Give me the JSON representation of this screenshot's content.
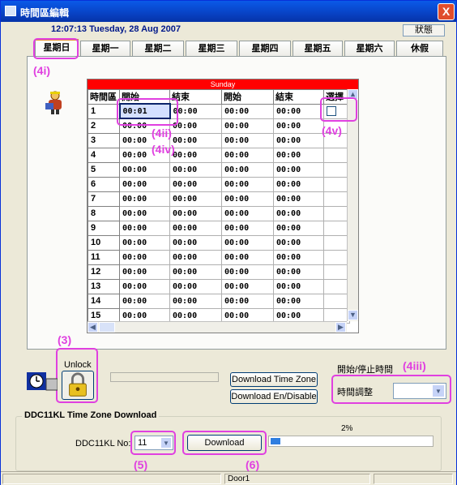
{
  "window": {
    "title": "時間區編輯",
    "close_glyph": "X",
    "clock_text": "12:07:13 Tuesday, 28 Aug 2007",
    "status_button": "狀態"
  },
  "tabs": [
    {
      "label": "星期日",
      "active": true
    },
    {
      "label": "星期一",
      "active": false
    },
    {
      "label": "星期二",
      "active": false
    },
    {
      "label": "星期三",
      "active": false
    },
    {
      "label": "星期四",
      "active": false
    },
    {
      "label": "星期五",
      "active": false
    },
    {
      "label": "星期六",
      "active": false
    },
    {
      "label": "休假",
      "active": false
    }
  ],
  "grid": {
    "day_banner": "Sunday",
    "headers": [
      "時間區",
      "開始",
      "結束",
      "開始",
      "結束",
      "選擇"
    ],
    "rows": [
      {
        "num": "1",
        "s1": "00:01",
        "e1": "00:00",
        "s2": "00:00",
        "e2": "00:00"
      },
      {
        "num": "2",
        "s1": "00:00",
        "e1": "00:00",
        "s2": "00:00",
        "e2": "00:00"
      },
      {
        "num": "3",
        "s1": "00:00",
        "e1": "00:00",
        "s2": "00:00",
        "e2": "00:00"
      },
      {
        "num": "4",
        "s1": "00:00",
        "e1": "00:00",
        "s2": "00:00",
        "e2": "00:00"
      },
      {
        "num": "5",
        "s1": "00:00",
        "e1": "00:00",
        "s2": "00:00",
        "e2": "00:00"
      },
      {
        "num": "6",
        "s1": "00:00",
        "e1": "00:00",
        "s2": "00:00",
        "e2": "00:00"
      },
      {
        "num": "7",
        "s1": "00:00",
        "e1": "00:00",
        "s2": "00:00",
        "e2": "00:00"
      },
      {
        "num": "8",
        "s1": "00:00",
        "e1": "00:00",
        "s2": "00:00",
        "e2": "00:00"
      },
      {
        "num": "9",
        "s1": "00:00",
        "e1": "00:00",
        "s2": "00:00",
        "e2": "00:00"
      },
      {
        "num": "10",
        "s1": "00:00",
        "e1": "00:00",
        "s2": "00:00",
        "e2": "00:00"
      },
      {
        "num": "11",
        "s1": "00:00",
        "e1": "00:00",
        "s2": "00:00",
        "e2": "00:00"
      },
      {
        "num": "12",
        "s1": "00:00",
        "e1": "00:00",
        "s2": "00:00",
        "e2": "00:00"
      },
      {
        "num": "13",
        "s1": "00:00",
        "e1": "00:00",
        "s2": "00:00",
        "e2": "00:00"
      },
      {
        "num": "14",
        "s1": "00:00",
        "e1": "00:00",
        "s2": "00:00",
        "e2": "00:00"
      },
      {
        "num": "15",
        "s1": "00:00",
        "e1": "00:00",
        "s2": "00:00",
        "e2": "00:00"
      }
    ]
  },
  "annotations": {
    "a3": "(3)",
    "a4i": "(4i)",
    "a4ii": "(4ii)",
    "a4iii": "(4iii)",
    "a4iv": "(4iv)",
    "a4v": "(4v)",
    "a5": "(5)",
    "a6": "(6)"
  },
  "controls": {
    "unlock_label": "Unlock",
    "download_time_zone": "Download Time Zone",
    "download_en_disable": "Download En/Disable",
    "start_stop_time_label": "開始/停止時間",
    "time_adjust_label": "時間調整",
    "time_adjust_value": ""
  },
  "ddc": {
    "group_title": "DDC11KL Time Zone Download",
    "no_label": "DDC11KL No:",
    "no_value": "11",
    "download_button": "Download",
    "progress_text": "2%",
    "progress_fraction": 0.02
  },
  "statusbar": {
    "door": "Door1"
  },
  "icons": {
    "window": "window-app-icon",
    "close": "close-icon",
    "person": "person-avatar-icon",
    "lock": "padlock-icon",
    "clock": "clock-icon",
    "dropdown": "chevron-down-icon"
  }
}
